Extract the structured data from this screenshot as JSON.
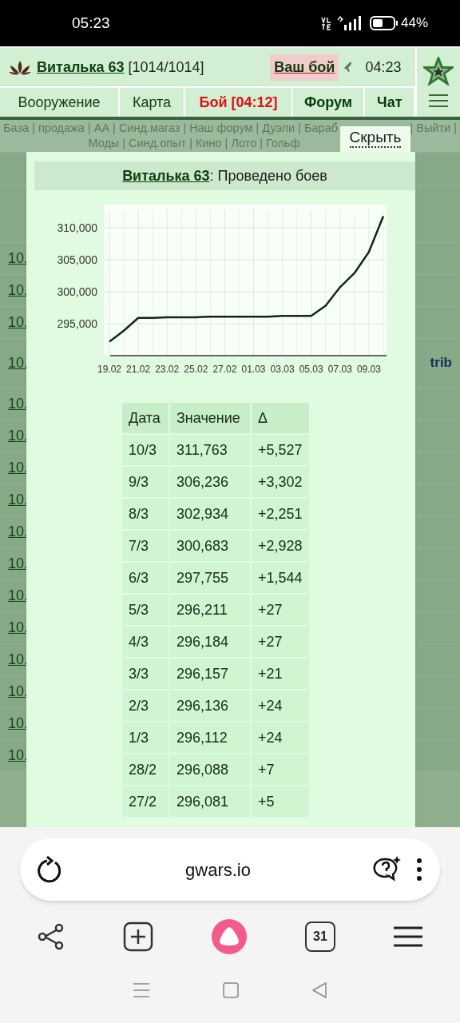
{
  "status_bar": {
    "time": "05:23",
    "battery": "44%"
  },
  "header": {
    "player_name": "Виталька 63",
    "hp": "[1014/1014]",
    "battle_link": "Ваш бой",
    "timer": "04:23"
  },
  "nav": [
    {
      "label": "Вооружение",
      "kind": "normal"
    },
    {
      "label": "Карта",
      "kind": "normal"
    },
    {
      "label": "Бой [04:12]",
      "kind": "alert"
    },
    {
      "label": "Форум",
      "kind": "bold"
    },
    {
      "label": "Чат",
      "kind": "bold"
    }
  ],
  "links": {
    "line1_left": "База | продажа | АА | Синд.магаз | Наш форум | Дуэли | Бараб",
    "line1_right": "| Выйти |",
    "line2": "Моды | Синд.опыт | Кино | Лото | Гольф"
  },
  "hide_button": "Скрыть",
  "background_rows": [
    {
      "link": ""
    },
    {
      "link": ""
    },
    {
      "link": "10."
    },
    {
      "link": "10."
    },
    {
      "link": "10."
    },
    {
      "link": "10.",
      "note": "trib"
    },
    {
      "link": "10."
    },
    {
      "link": "10."
    },
    {
      "link": "10."
    },
    {
      "link": "10."
    },
    {
      "link": "10."
    },
    {
      "link": "10."
    },
    {
      "link": "10."
    },
    {
      "link": "10."
    },
    {
      "link": "10."
    },
    {
      "link": "10."
    },
    {
      "link": "10."
    },
    {
      "link": "10."
    }
  ],
  "popup": {
    "title_name": "Виталька 63",
    "title_rest": ": Проведено боев",
    "chart_data": {
      "type": "line",
      "grid": true,
      "categories": [
        "19.02",
        null,
        "21.02",
        null,
        "23.02",
        null,
        "25.02",
        null,
        "27.02",
        null,
        "01.03",
        null,
        "03.03",
        null,
        "05.03",
        null,
        "07.03",
        null,
        "09.03",
        null
      ],
      "series": [
        {
          "color": "#0f2a0f",
          "values": [
            292200,
            293900,
            295900,
            295900,
            296000,
            296000,
            296000,
            296100,
            296100,
            296100,
            296100,
            296100,
            296200,
            296200,
            296200,
            297800,
            300700,
            302900,
            306200,
            311800
          ]
        }
      ],
      "ylim": [
        290000,
        313600
      ],
      "yticks": [
        {
          "value": 295000,
          "label": "295,000"
        },
        {
          "value": 300000,
          "label": "300,000"
        },
        {
          "value": 305000,
          "label": "305,000"
        },
        {
          "value": 310000,
          "label": "310,000"
        }
      ]
    },
    "table": {
      "columns": [
        "Дата",
        "Значение",
        "Δ"
      ],
      "rows": [
        [
          "10/3",
          "311,763",
          "+5,527"
        ],
        [
          "9/3",
          "306,236",
          "+3,302"
        ],
        [
          "8/3",
          "302,934",
          "+2,251"
        ],
        [
          "7/3",
          "300,683",
          "+2,928"
        ],
        [
          "6/3",
          "297,755",
          "+1,544"
        ],
        [
          "5/3",
          "296,211",
          "+27"
        ],
        [
          "4/3",
          "296,184",
          "+27"
        ],
        [
          "3/3",
          "296,157",
          "+21"
        ],
        [
          "2/3",
          "296,136",
          "+24"
        ],
        [
          "1/3",
          "296,112",
          "+24"
        ],
        [
          "28/2",
          "296,088",
          "+7"
        ],
        [
          "27/2",
          "296,081",
          "+5"
        ]
      ]
    }
  },
  "browser": {
    "url": "gwars.io",
    "tabs_count": "31"
  }
}
